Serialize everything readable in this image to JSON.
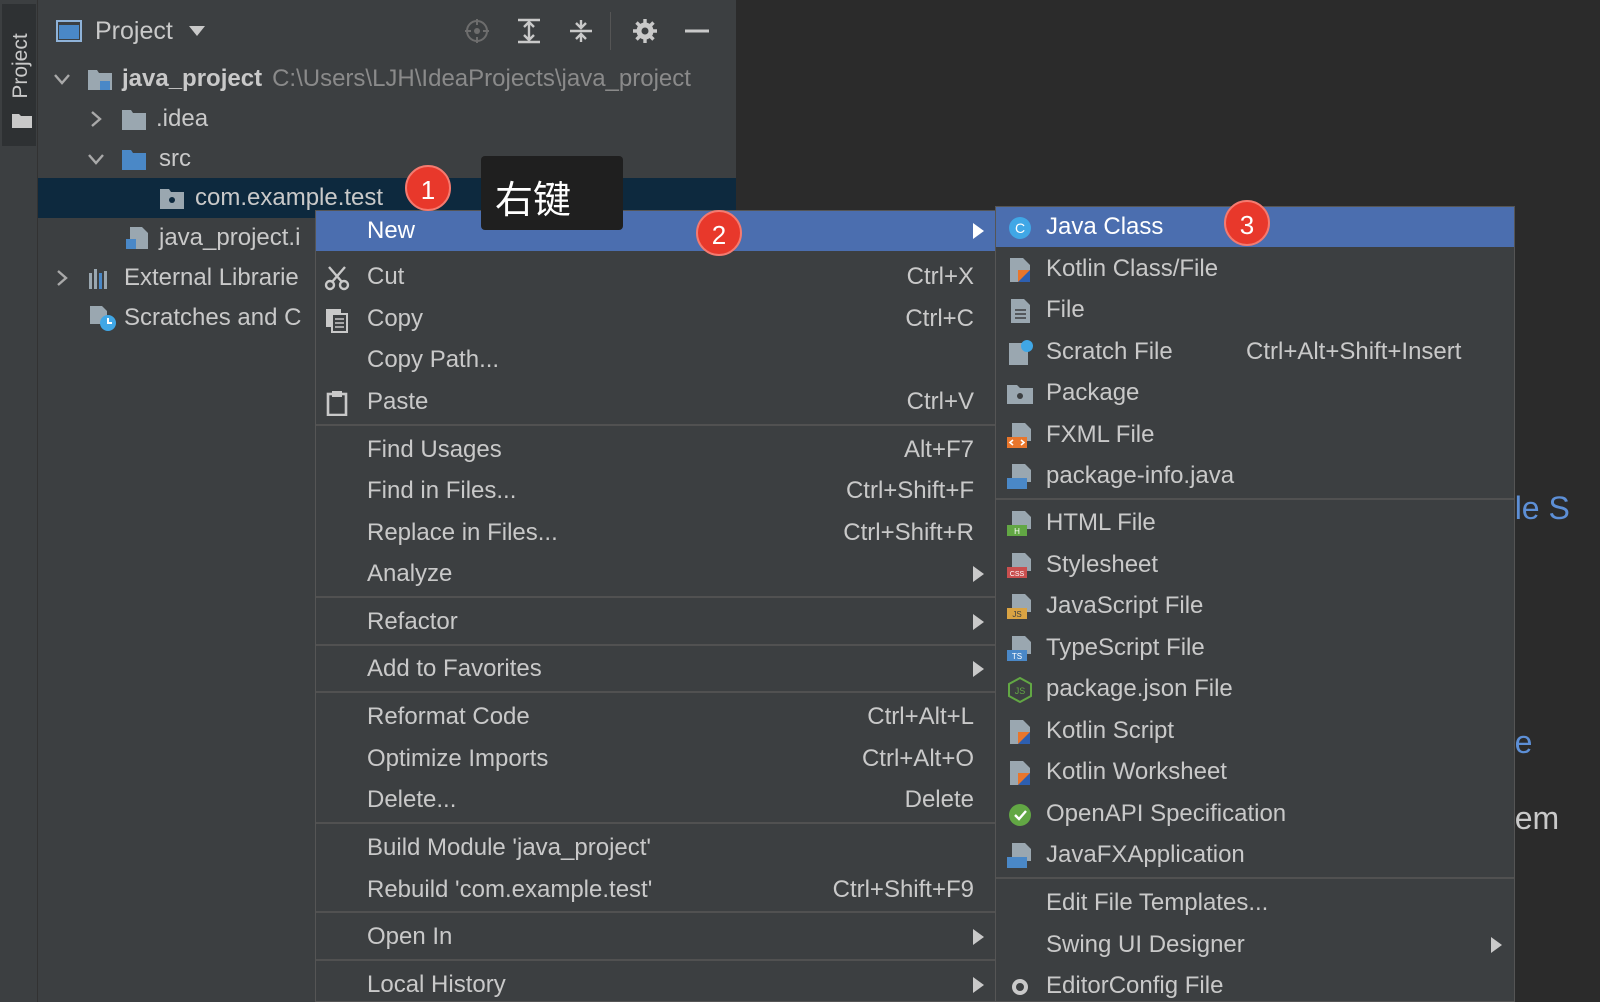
{
  "strip": {
    "label": "Project"
  },
  "panel": {
    "title": "Project",
    "tree": {
      "root_label": "java_project",
      "root_path": "C:\\Users\\LJH\\IdeaProjects\\java_project",
      "idea": ".idea",
      "src": "src",
      "package": "com.example.test",
      "iml": "java_project.i",
      "external": "External Librarie",
      "scratches": "Scratches and C"
    }
  },
  "tooltip": {
    "text": "右键"
  },
  "badges": [
    "1",
    "2",
    "3"
  ],
  "editor_fragments": [
    "ıble S",
    "me",
    "them"
  ],
  "context_menu": {
    "new": "New",
    "cut": "Cut",
    "cut_sc": "Ctrl+X",
    "copy": "Copy",
    "copy_sc": "Ctrl+C",
    "copy_path": "Copy Path...",
    "paste": "Paste",
    "paste_sc": "Ctrl+V",
    "find_usages": "Find Usages",
    "find_usages_sc": "Alt+F7",
    "find_files": "Find in Files...",
    "find_files_sc": "Ctrl+Shift+F",
    "replace_files": "Replace in Files...",
    "replace_files_sc": "Ctrl+Shift+R",
    "analyze": "Analyze",
    "refactor": "Refactor",
    "favorites": "Add to Favorites",
    "reformat": "Reformat Code",
    "reformat_sc": "Ctrl+Alt+L",
    "optimize": "Optimize Imports",
    "optimize_sc": "Ctrl+Alt+O",
    "delete": "Delete...",
    "delete_sc": "Delete",
    "build": "Build Module 'java_project'",
    "rebuild": "Rebuild 'com.example.test'",
    "rebuild_sc": "Ctrl+Shift+F9",
    "open_in": "Open In",
    "local_history": "Local History"
  },
  "submenu": {
    "java_class": "Java Class",
    "kotlin_class": "Kotlin Class/File",
    "file": "File",
    "scratch": "Scratch File",
    "scratch_sc": "Ctrl+Alt+Shift+Insert",
    "package": "Package",
    "fxml": "FXML File",
    "pkg_info": "package-info.java",
    "html": "HTML File",
    "stylesheet": "Stylesheet",
    "js": "JavaScript File",
    "ts": "TypeScript File",
    "pkg_json": "package.json File",
    "kotlin_script": "Kotlin Script",
    "kotlin_ws": "Kotlin Worksheet",
    "openapi": "OpenAPI Specification",
    "javafx": "JavaFXApplication",
    "edit_templates": "Edit File Templates...",
    "swing": "Swing UI Designer",
    "editorconfig": "EditorConfig File"
  },
  "colors": {
    "selection": "#4b6eaf",
    "badge": "#e8382b",
    "panel": "#3c3f41",
    "editor": "#2b2b2b"
  }
}
